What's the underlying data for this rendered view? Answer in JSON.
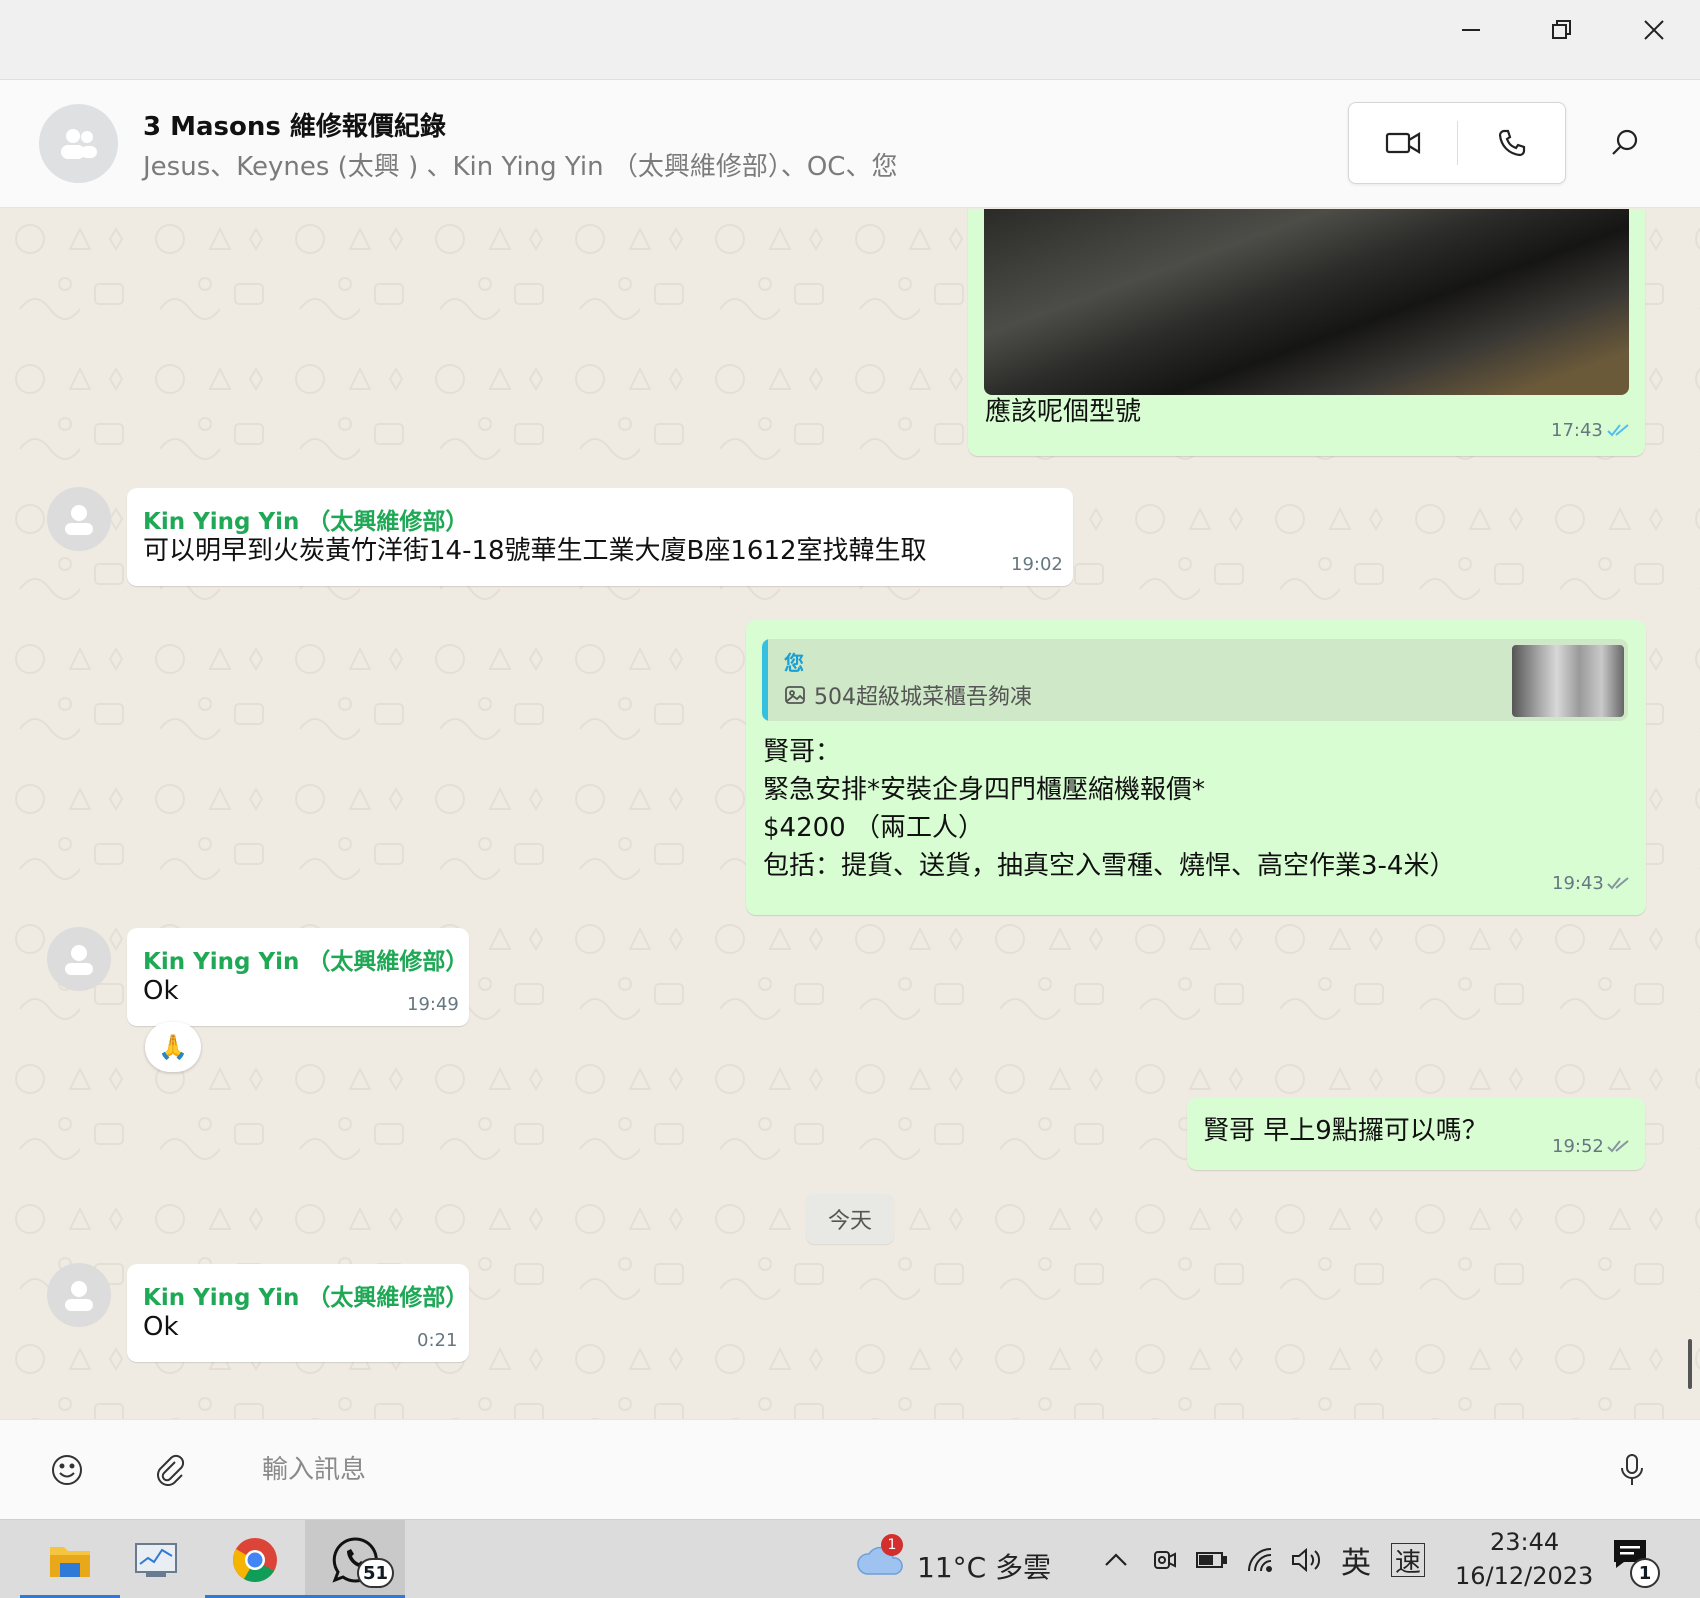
{
  "header": {
    "title": "3 Masons 維修報價紀錄",
    "members": "Jesus、Keynes (太興 ) 、Kin Ying Yin （太興維修部）、OC、您"
  },
  "messages": [
    {
      "type": "image",
      "direction": "out",
      "caption": "應該呢個型號",
      "time": "17:43",
      "status": "read"
    },
    {
      "type": "text",
      "direction": "in",
      "sender": "Kin Ying Yin （太興維修部）",
      "text": "可以明早到火炭黃竹洋街14-18號華生工業大廈B座1612室找韓生取",
      "time": "19:02"
    },
    {
      "type": "reply",
      "direction": "out",
      "quote": {
        "author": "您",
        "text": "504超級城菜櫃吾夠凍"
      },
      "lines": [
        "賢哥：",
        "緊急安排*安裝企身四門櫃壓縮機報價*",
        "$4200 （兩工人）",
        "包括：提貨、送貨，抽真空入雪種、燒悍、高空作業3-4米）"
      ],
      "time": "19:43",
      "status": "delivered"
    },
    {
      "type": "text",
      "direction": "in",
      "sender": "Kin Ying Yin （太興維修部）",
      "text": "Ok",
      "time": "19:49",
      "reaction": "🙏"
    },
    {
      "type": "text",
      "direction": "out",
      "text": "賢哥 早上9點攞可以嗎？",
      "time": "19:52",
      "status": "delivered"
    },
    {
      "type": "date",
      "text": "今天"
    },
    {
      "type": "text",
      "direction": "in",
      "sender": "Kin Ying Yin （太興維修部）",
      "text": "Ok",
      "time": "0:21"
    }
  ],
  "compose": {
    "placeholder": "輸入訊息"
  },
  "taskbar": {
    "apps": [
      "file-explorer",
      "task-manager",
      "chrome",
      "whatsapp"
    ],
    "whatsapp_badge": "51",
    "weather": {
      "badge": "1",
      "text": "11°C 多雲"
    },
    "ime_lang": "英",
    "ime_speed": "速",
    "time": "23:44",
    "date": "16/12/2023",
    "notifications": "1"
  },
  "colors": {
    "outgoing_bubble": "#d9fdd3",
    "incoming_bubble": "#ffffff",
    "sender_name": "#1fa855",
    "read_tick": "#53bdeb"
  }
}
